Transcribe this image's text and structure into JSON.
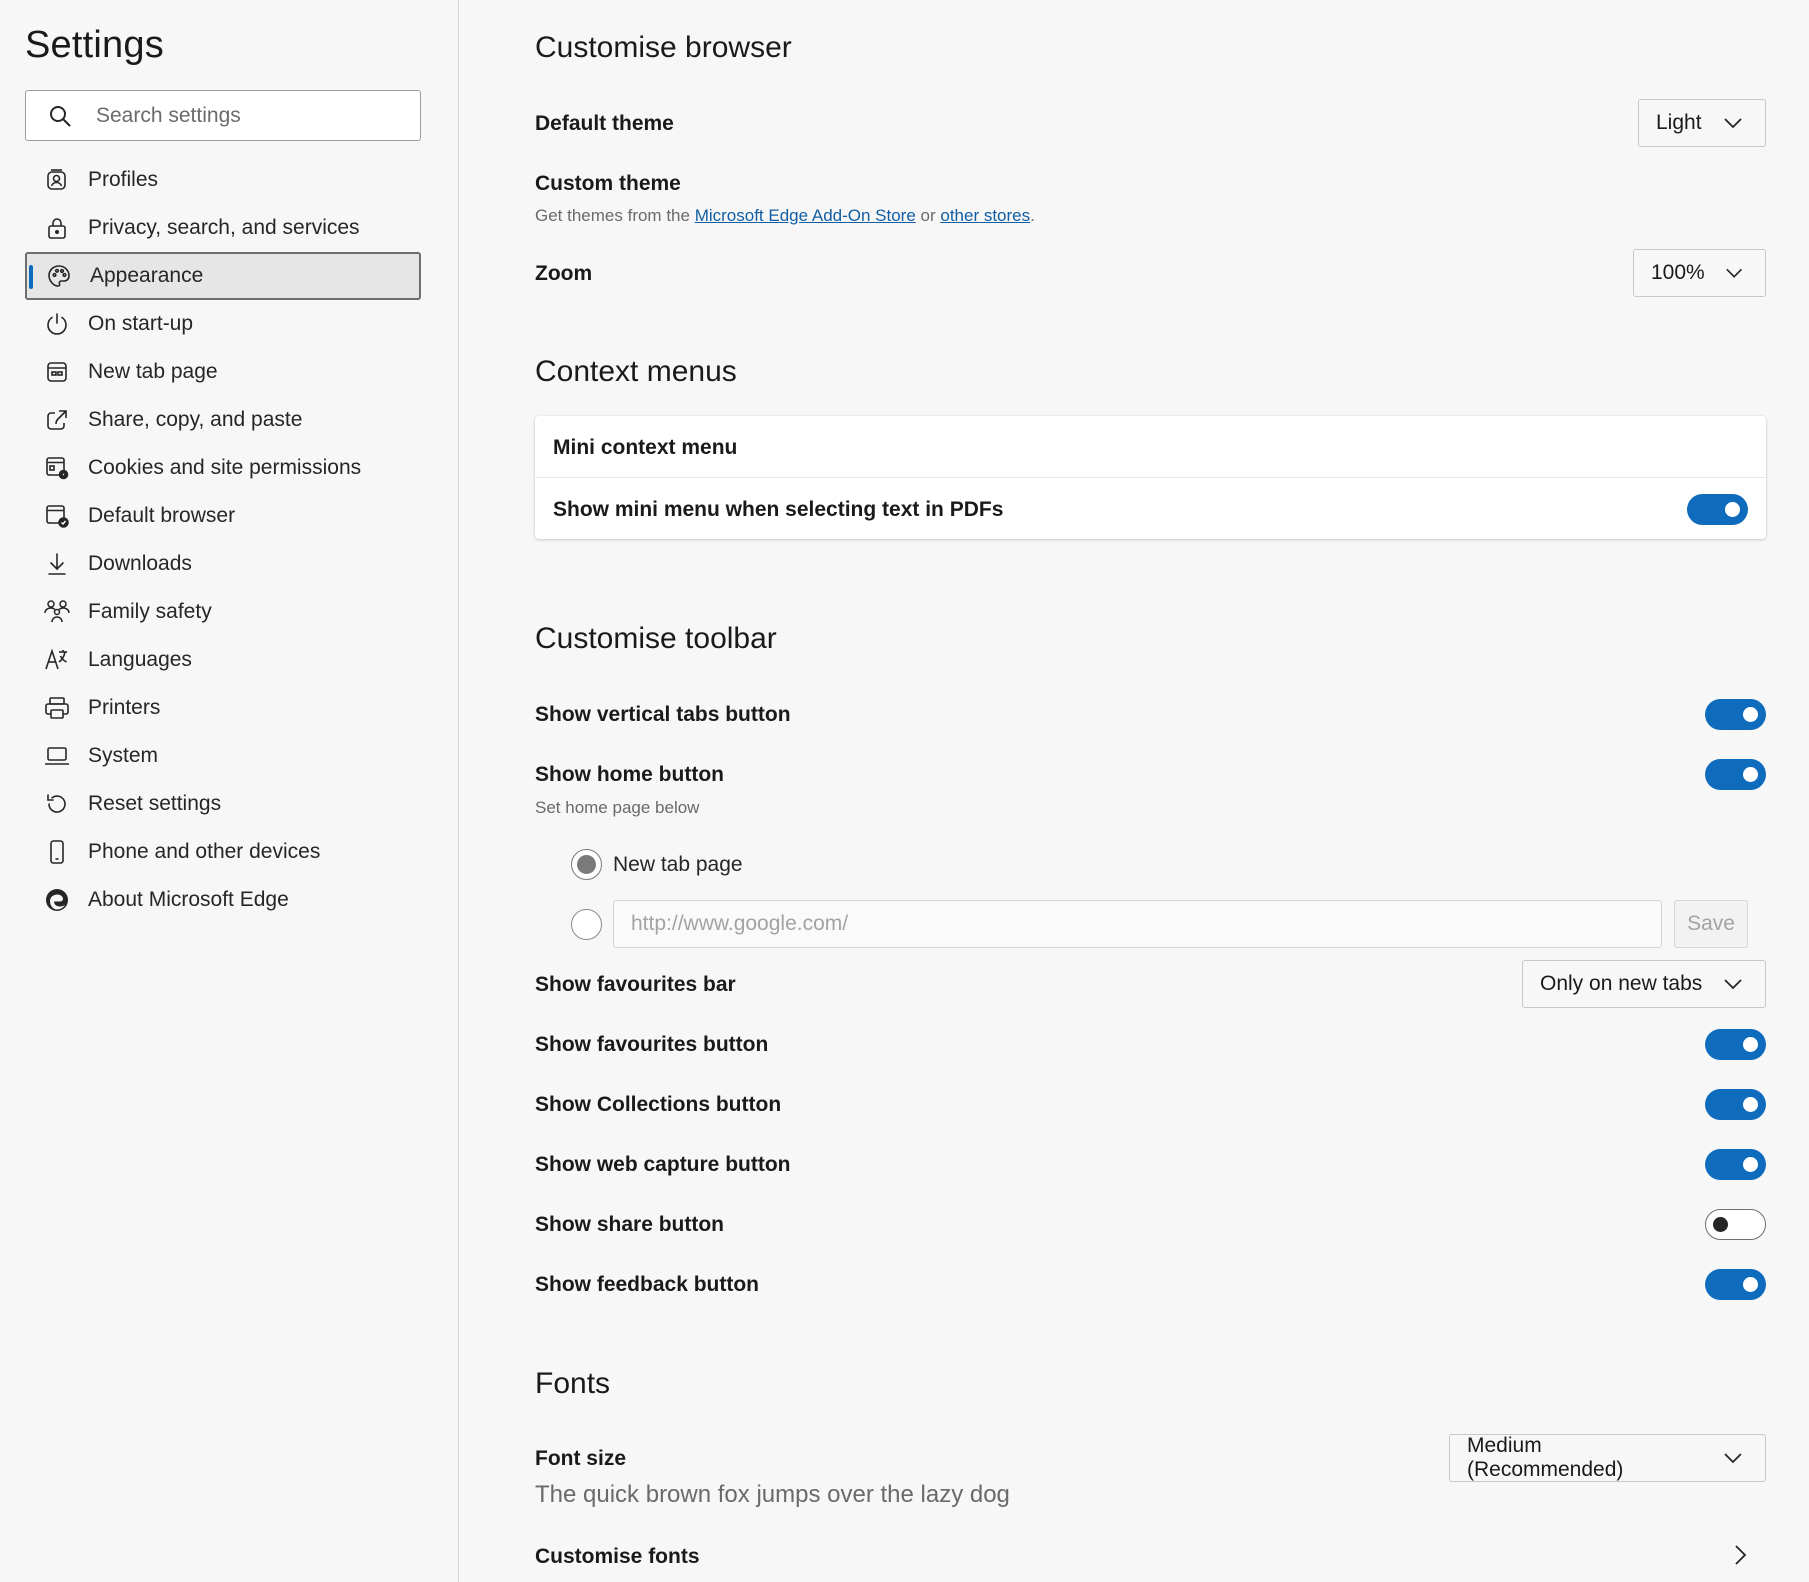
{
  "sidebar": {
    "title": "Settings",
    "search_placeholder": "Search settings",
    "items": [
      {
        "label": "Profiles",
        "icon": "profile-icon"
      },
      {
        "label": "Privacy, search, and services",
        "icon": "lock-icon"
      },
      {
        "label": "Appearance",
        "icon": "palette-icon",
        "active": true
      },
      {
        "label": "On start-up",
        "icon": "power-icon"
      },
      {
        "label": "New tab page",
        "icon": "new-tab-icon"
      },
      {
        "label": "Share, copy, and paste",
        "icon": "share-icon"
      },
      {
        "label": "Cookies and site permissions",
        "icon": "cookies-icon"
      },
      {
        "label": "Default browser",
        "icon": "default-browser-icon"
      },
      {
        "label": "Downloads",
        "icon": "download-icon"
      },
      {
        "label": "Family safety",
        "icon": "family-icon"
      },
      {
        "label": "Languages",
        "icon": "languages-icon"
      },
      {
        "label": "Printers",
        "icon": "printer-icon"
      },
      {
        "label": "System",
        "icon": "laptop-icon"
      },
      {
        "label": "Reset settings",
        "icon": "reset-icon"
      },
      {
        "label": "Phone and other devices",
        "icon": "phone-icon"
      },
      {
        "label": "About Microsoft Edge",
        "icon": "edge-logo-icon"
      }
    ]
  },
  "customise_browser": {
    "heading": "Customise browser",
    "default_theme": {
      "label": "Default theme",
      "value": "Light"
    },
    "custom_theme": {
      "label": "Custom theme",
      "desc_prefix": "Get themes from the ",
      "link1": "Microsoft Edge Add-On Store",
      "desc_mid": " or ",
      "link2": "other stores",
      "desc_suffix": "."
    },
    "zoom": {
      "label": "Zoom",
      "value": "100%"
    }
  },
  "context_menus": {
    "heading": "Context menus",
    "card_title": "Mini context menu",
    "pdf_row": {
      "label": "Show mini menu when selecting text in PDFs",
      "on": true
    }
  },
  "toolbar": {
    "heading": "Customise toolbar",
    "vertical_tabs": {
      "label": "Show vertical tabs button",
      "on": true
    },
    "home_button": {
      "label": "Show home button",
      "on": true,
      "sub": "Set home page below"
    },
    "home_options": {
      "new_tab_label": "New tab page",
      "url_placeholder": "http://www.google.com/",
      "save_label": "Save",
      "selected": "new-tab"
    },
    "favourites_bar": {
      "label": "Show favourites bar",
      "value": "Only on new tabs"
    },
    "favourites_button": {
      "label": "Show favourites button",
      "on": true
    },
    "collections_button": {
      "label": "Show Collections button",
      "on": true
    },
    "web_capture_button": {
      "label": "Show web capture button",
      "on": true
    },
    "share_button": {
      "label": "Show share button",
      "on": false
    },
    "feedback_button": {
      "label": "Show feedback button",
      "on": true
    }
  },
  "fonts": {
    "heading": "Fonts",
    "font_size": {
      "label": "Font size",
      "value": "Medium (Recommended)"
    },
    "preview": "The quick brown fox jumps over the lazy dog",
    "customise_fonts": "Customise fonts"
  },
  "colors": {
    "accent": "#0f6cbd",
    "link": "#115ea3"
  }
}
